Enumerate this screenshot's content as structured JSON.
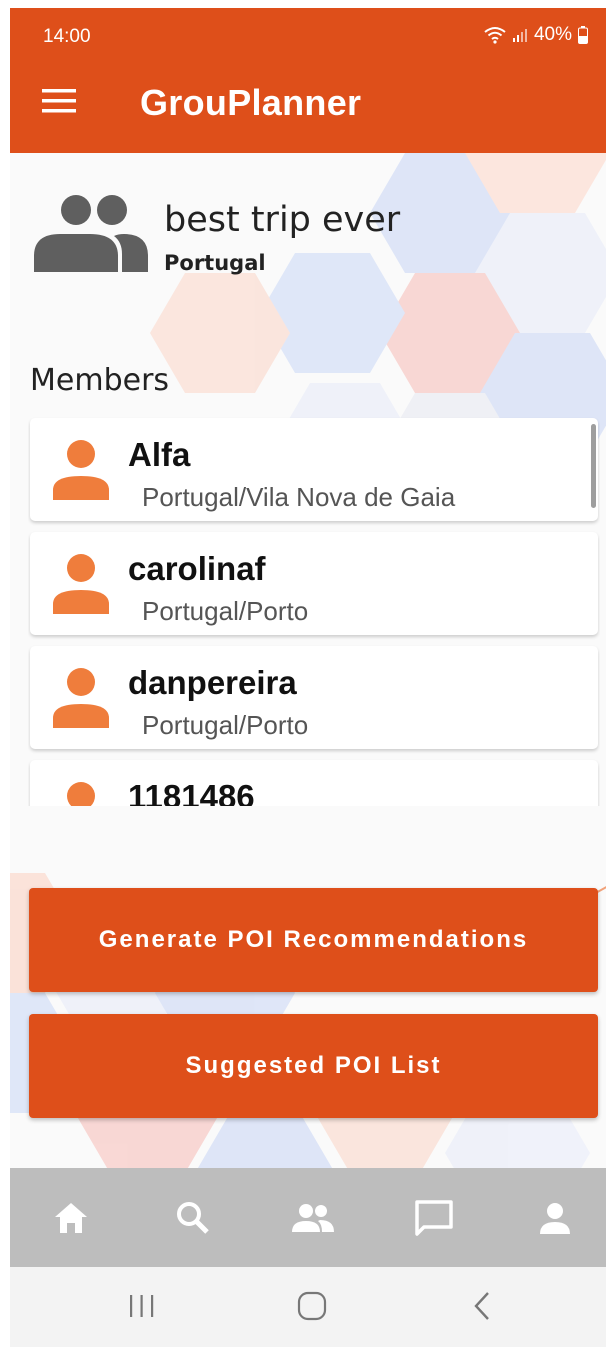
{
  "status_bar": {
    "time": "14:00",
    "battery": "40%"
  },
  "app_bar": {
    "title": "GrouPlanner",
    "menu_icon": "hamburger-menu-icon"
  },
  "group": {
    "name": "best trip ever",
    "country": "Portugal",
    "icon": "group-people-icon"
  },
  "members_section": {
    "title": "Members"
  },
  "members": [
    {
      "name": "Alfa",
      "location": "Portugal/Vila Nova de Gaia"
    },
    {
      "name": "carolinaf",
      "location": "Portugal/Porto"
    },
    {
      "name": "danpereira",
      "location": "Portugal/Porto"
    },
    {
      "name": "1181486",
      "location": ""
    }
  ],
  "actions": {
    "generate_label": "Generate POI Recommendations",
    "suggested_label": "Suggested POI List"
  },
  "bottom_nav": [
    "home-icon",
    "search-icon",
    "groups-icon",
    "chat-icon",
    "profile-icon"
  ],
  "system_nav": [
    "recents-icon",
    "home-circle-icon",
    "back-icon"
  ],
  "colors": {
    "primary": "#de4f1a",
    "member_icon": "#ef7d3c",
    "group_icon": "#5f5f5f",
    "nav_bar": "#bdbdbd"
  }
}
